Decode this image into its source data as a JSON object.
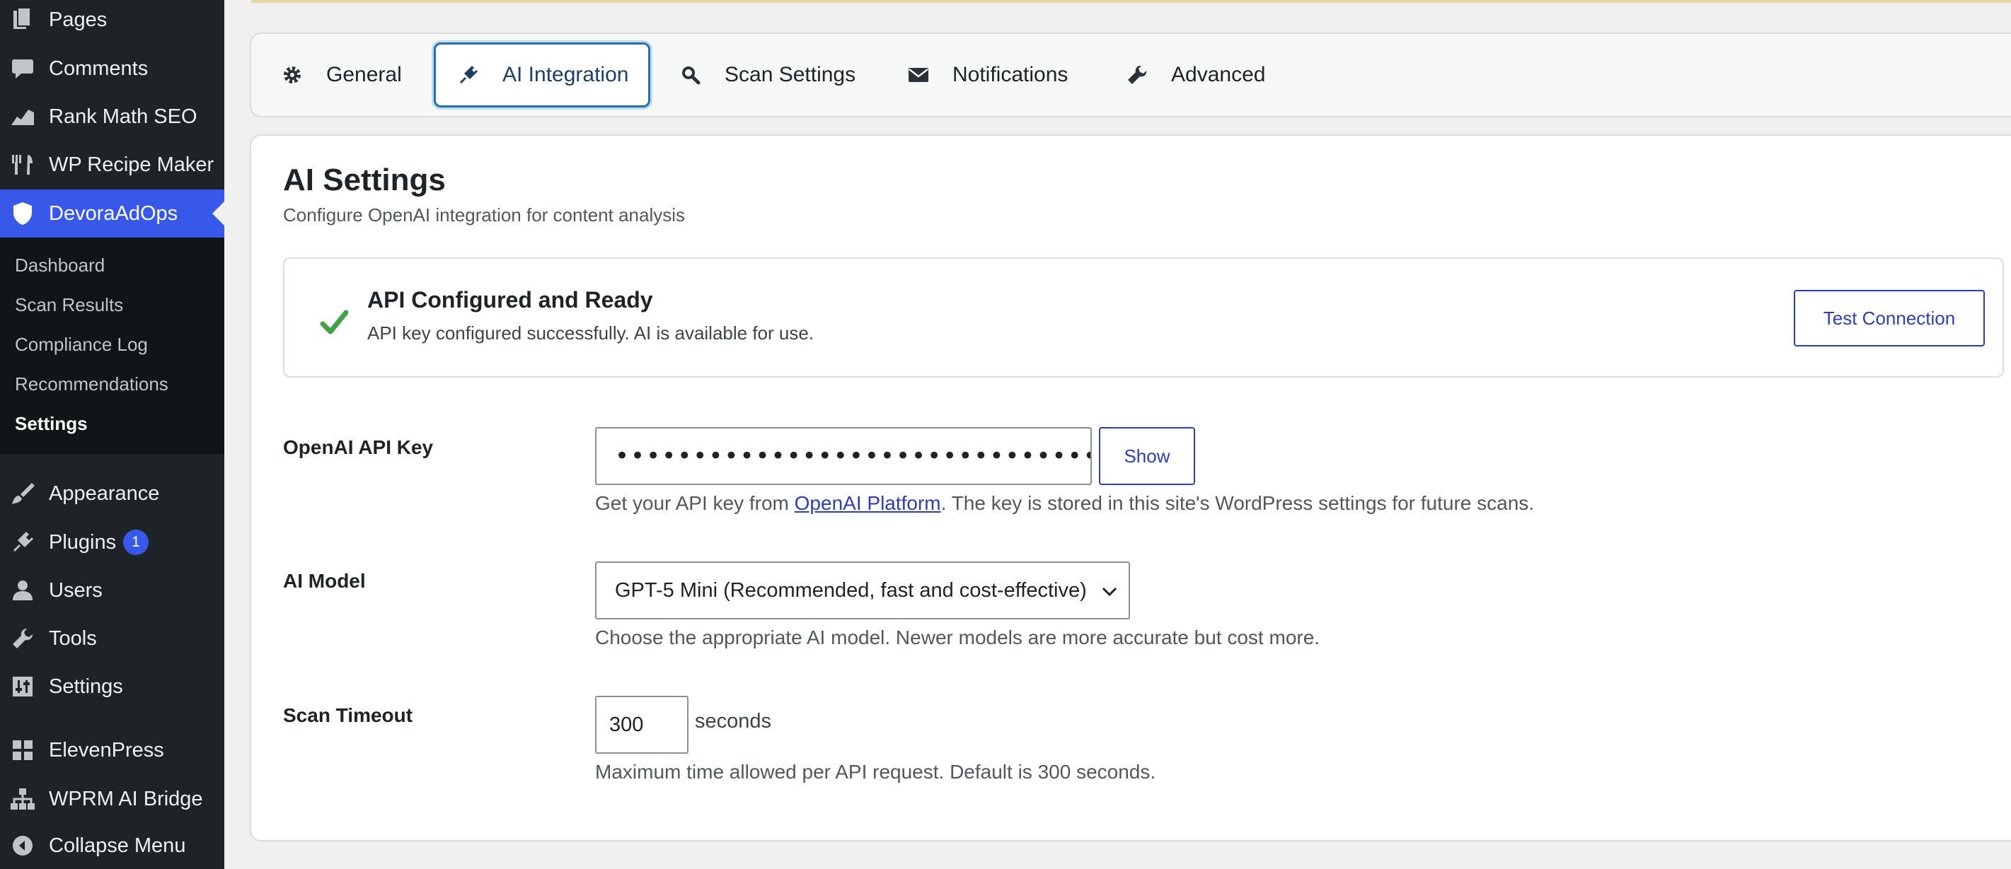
{
  "sidebar": {
    "top_items": [
      {
        "label": "Pages",
        "icon": "pages-icon"
      },
      {
        "label": "Comments",
        "icon": "comments-icon"
      },
      {
        "label": "Rank Math SEO",
        "icon": "rank-math-icon"
      },
      {
        "label": "WP Recipe Maker",
        "icon": "recipe-icon"
      },
      {
        "label": "DevoraAdOps",
        "icon": "shield-icon"
      }
    ],
    "submenu": [
      "Dashboard",
      "Scan Results",
      "Compliance Log",
      "Recommendations",
      "Settings"
    ],
    "bottom_items": [
      {
        "label": "Appearance",
        "icon": "appearance-icon"
      },
      {
        "label": "Plugins",
        "icon": "plugins-icon",
        "badge": "1"
      },
      {
        "label": "Users",
        "icon": "users-icon"
      },
      {
        "label": "Tools",
        "icon": "tools-icon"
      },
      {
        "label": "Settings",
        "icon": "settings-icon"
      },
      {
        "label": "ElevenPress",
        "icon": "grid-icon"
      },
      {
        "label": "WPRM AI Bridge",
        "icon": "network-icon"
      },
      {
        "label": "Collapse Menu",
        "icon": "collapse-icon"
      }
    ],
    "active_color": "#3858e9"
  },
  "tabs": [
    {
      "label": "General",
      "icon": "gear-icon"
    },
    {
      "label": "AI Integration",
      "icon": "plugin-icon",
      "active": true
    },
    {
      "label": "Scan Settings",
      "icon": "search-icon"
    },
    {
      "label": "Notifications",
      "icon": "envelope-icon"
    },
    {
      "label": "Advanced",
      "icon": "wrench-icon"
    }
  ],
  "main": {
    "title": "AI Settings",
    "subtitle": "Configure OpenAI integration for content analysis",
    "status": {
      "title": "API Configured and Ready",
      "message": "API key configured successfully. AI is available for use.",
      "button": "Test Connection",
      "color": "#46a049"
    },
    "api_key": {
      "label": "OpenAI API Key",
      "value": "•••••••••••••••••••••••••••••••••••••••••••••••••••",
      "show_button": "Show",
      "help_before": "Get your API key from ",
      "help_link": "OpenAI Platform",
      "help_after": ". The key is stored in this site's WordPress settings for future scans."
    },
    "model": {
      "label": "AI Model",
      "selected": "GPT-5 Mini (Recommended, fast and cost-effective)",
      "help": "Choose the appropriate AI model. Newer models are more accurate but cost more."
    },
    "timeout": {
      "label": "Scan Timeout",
      "value": "300",
      "unit": "seconds",
      "help": "Maximum time allowed per API request. Default is 300 seconds."
    }
  }
}
